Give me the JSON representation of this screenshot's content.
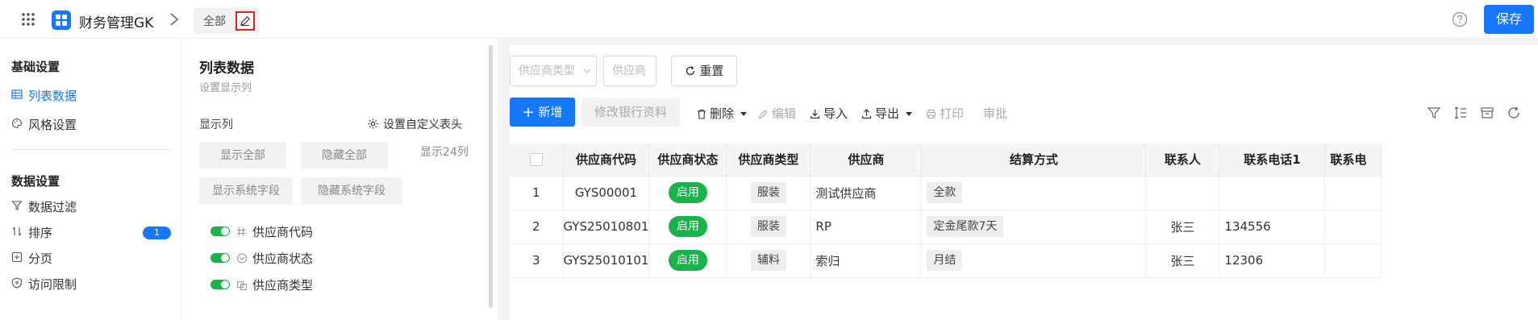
{
  "topbar": {
    "app_name": "财务管理GK",
    "breadcrumb_tag": "全部",
    "save_label": "保存",
    "colors": {
      "primary": "#1677ff",
      "highlight_border": "#e0261b"
    }
  },
  "sidebar": {
    "section1": "基础设置",
    "items1": [
      {
        "label": "列表数据",
        "icon": "table-icon",
        "active": true
      },
      {
        "label": "风格设置",
        "icon": "palette-icon",
        "active": false
      }
    ],
    "section2": "数据设置",
    "items2": [
      {
        "label": "数据过滤",
        "icon": "filter-icon"
      },
      {
        "label": "排序",
        "icon": "sort-icon",
        "badge": "1"
      },
      {
        "label": "分页",
        "icon": "pagination-icon"
      },
      {
        "label": "访问限制",
        "icon": "shield-icon"
      }
    ]
  },
  "config": {
    "title": "列表数据",
    "subtitle": "设置显示列",
    "show_cols_label": "显示列",
    "custom_header_label": "设置自定义表头",
    "show_all": "显示全部",
    "hide_all": "隐藏全部",
    "count_label": "显示24列",
    "show_sys": "显示系统字段",
    "hide_sys": "隐藏系统字段",
    "fields": [
      {
        "label": "供应商代码",
        "icon": "hash-icon",
        "enabled": true
      },
      {
        "label": "供应商状态",
        "icon": "dropdown-circle-icon",
        "enabled": true
      },
      {
        "label": "供应商类型",
        "icon": "copy-icon",
        "enabled": true
      }
    ]
  },
  "filters": {
    "type_placeholder": "供应商类型",
    "supplier_placeholder": "供应商",
    "reset_label": "重置"
  },
  "toolbar": {
    "add": "新增",
    "bank": "修改银行资料",
    "delete": "删除",
    "edit": "编辑",
    "import": "导入",
    "export": "导出",
    "print": "打印",
    "approve": "审批"
  },
  "table": {
    "headers": [
      "供应商代码",
      "供应商状态",
      "供应商类型",
      "供应商",
      "结算方式",
      "联系人",
      "联系电话1",
      "联系电"
    ],
    "rows": [
      {
        "no": "1",
        "code": "GYS00001",
        "status": "启用",
        "type": "服装",
        "name": "测试供应商",
        "settle": "全款",
        "contact": "",
        "phone": ""
      },
      {
        "no": "2",
        "code": "GYS25010801",
        "status": "启用",
        "type": "服装",
        "name": "RP",
        "settle": "定金尾款7天",
        "contact": "张三",
        "phone": "134556"
      },
      {
        "no": "3",
        "code": "GYS25010101",
        "status": "启用",
        "type": "辅料",
        "name": "索归",
        "settle": "月结",
        "contact": "张三",
        "phone": "12306"
      }
    ]
  }
}
